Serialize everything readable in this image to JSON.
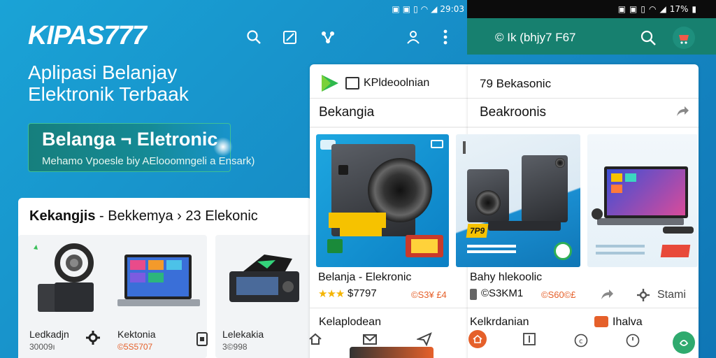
{
  "status_left": {
    "time": "29:03"
  },
  "status_right": {
    "battery": "17%"
  },
  "left_app": {
    "logo": "KIPAS777",
    "tagline_line1": "Aplipasi Belanjay",
    "tagline_line2": "Elektronik Terbaak",
    "banner_title": "Belanga ¬ Eletronic",
    "banner_subtitle": "Mehamo Vpoesle biy AElooomngeli a Ensark)",
    "panel_title_bold": "Kekangjis",
    "panel_title_rest": " - Bekkemya › 23 Elekonic",
    "products": [
      {
        "name": "Ledkadjn",
        "price": "30009ı"
      },
      {
        "name": "Kektonia",
        "price": "©5S5707"
      },
      {
        "name": "Lelekakia",
        "price": "3©998"
      }
    ]
  },
  "mid_panel": {
    "category_label": "KPldeoolnian",
    "section_title": "Bekangia",
    "product_name": "Belanja - Elekronic",
    "product_price": "$7797",
    "product_price_red": "©S3¥ £4",
    "sale_tag": "7P9",
    "bottom_label": "Kelaplodean"
  },
  "right_panel": {
    "appbar_text": "© Ik (bhjy7 F67",
    "header_count": "79 Bekasonic",
    "section_title": "Beakroonis",
    "product_name": "Bahy hlekoolic",
    "product_price": "©S3KM1",
    "product_price_red": "©S60©£",
    "share_text": "Stami",
    "bottom_label": "Kelkrdanian",
    "bottom_label2": "Ihalva"
  },
  "colors": {
    "bg_blue": "#1689c4",
    "teal_appbar": "#17806f",
    "accent_orange": "#e5602a",
    "fab_green": "#2faa6e"
  }
}
